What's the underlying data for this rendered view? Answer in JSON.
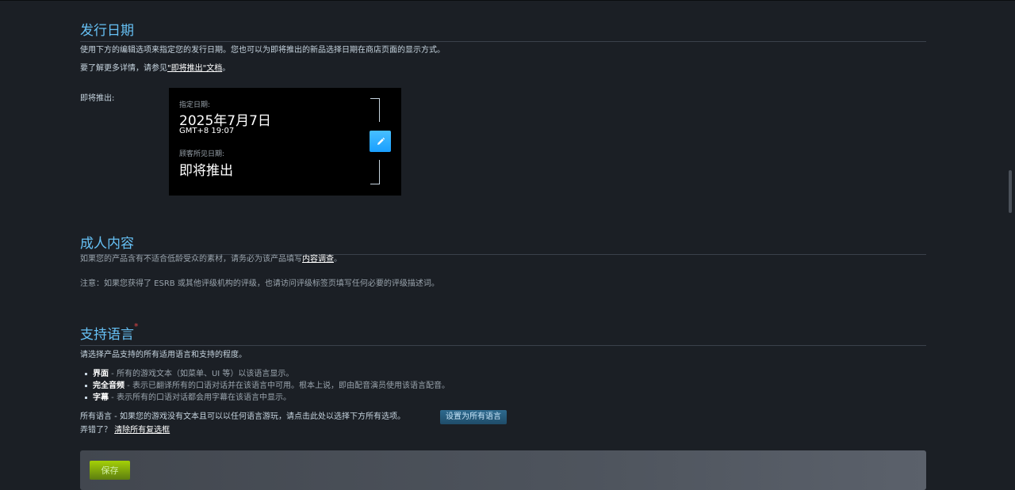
{
  "release": {
    "title": "发行日期",
    "desc": "使用下方的编辑选项来指定您的发行日期。您也可以为即将推出的新品选择日期在商店页面的显示方式。",
    "more_prefix": "要了解更多详情，请参见",
    "more_link": "\"即将推出\"文档",
    "more_suffix": "。",
    "coming_soon_label": "即将推出:",
    "box": {
      "specified_label": "指定日期:",
      "date": "2025年7月7日",
      "time": "GMT+8 19:07",
      "customer_label": "顾客所见日期:",
      "customer_value": "即将推出",
      "edit_icon": "pencil-icon"
    }
  },
  "adult": {
    "title": "成人内容",
    "desc_prefix": "如果您的产品含有不适合低龄受众的素材，请务必为该产品填写",
    "desc_link": "内容调查",
    "desc_suffix": "。",
    "note": "注意：如果您获得了 ESRB 或其他评级机构的评级，也请访问评级标签页填写任何必要的评级描述词。"
  },
  "languages": {
    "title": "支持语言",
    "required_mark": "*",
    "intro": "请选择产品支持的所有适用语言和支持的程度。",
    "items": [
      {
        "term": "界面",
        "desc": " - 所有的游戏文本（如菜单、UI 等）以该语言显示。"
      },
      {
        "term": "完全音频",
        "desc": " - 表示已翻译所有的口语对话并在该语言中可用。根本上说，即由配音演员使用该语言配音。"
      },
      {
        "term": "字幕",
        "desc": " - 表示所有的口语对话都会用字幕在该语言中显示。"
      }
    ],
    "all_text": "所有语言 - 如果您的游戏没有文本且可以以任何语言游玩，请点击此处以选择下方所有选项。",
    "set_all_button": "设置为所有语言",
    "mistake_prefix": "弄错了？",
    "clear_link": "清除所有复选框"
  },
  "save": {
    "label": "保存"
  },
  "colors": {
    "accent": "#66c0f4",
    "save_green": "#a4d007",
    "edit_blue": "#1a9fff",
    "background": "#1b1f25"
  }
}
